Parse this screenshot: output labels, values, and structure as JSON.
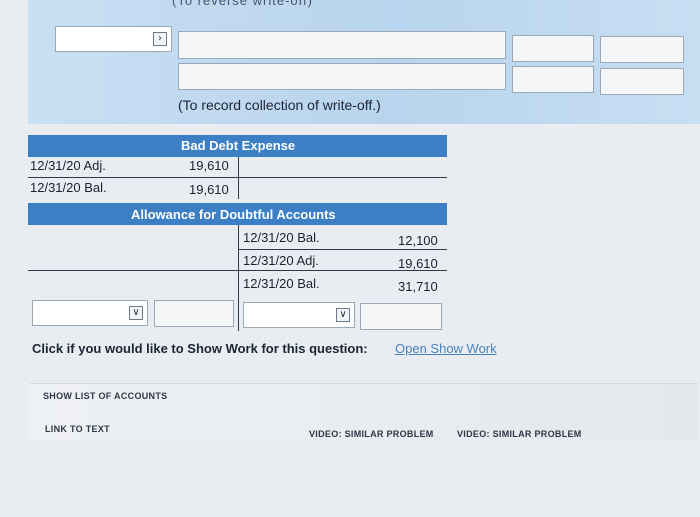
{
  "cut_header": "(To reverse write-off)",
  "journal": {
    "row1": {
      "account_value": "",
      "debit": "",
      "credit": ""
    },
    "row2": {
      "account_value": "",
      "debit": "",
      "credit": ""
    },
    "note": "(To record collection of write-off.)"
  },
  "bad_debt_expense": {
    "title": "Bad Debt Expense",
    "rows": [
      {
        "label": "12/31/20 Adj.",
        "value": "19,610"
      },
      {
        "label": "12/31/20 Bal.",
        "value": "19,610"
      }
    ]
  },
  "allowance": {
    "title": "Allowance for Doubtful Accounts",
    "rows": [
      {
        "label": "12/31/20 Bal.",
        "value": "12,100"
      },
      {
        "label": "12/31/20 Adj.",
        "value": "19,610"
      },
      {
        "label": "12/31/20 Bal.",
        "value": "31,710"
      }
    ]
  },
  "show_work": {
    "question": "Click if you would like to Show Work for this question:",
    "link": "Open Show Work"
  },
  "buttons": {
    "show_accounts": "SHOW LIST OF ACCOUNTS",
    "link_to_text": "LINK TO TEXT",
    "video1": "VIDEO: SIMILAR PROBLEM",
    "video2": "VIDEO: SIMILAR PROBLEM"
  },
  "colors": {
    "header_blue": "#3d7fc4",
    "panel_blue": "#c2d9f0",
    "link_blue": "#4a82bd"
  }
}
